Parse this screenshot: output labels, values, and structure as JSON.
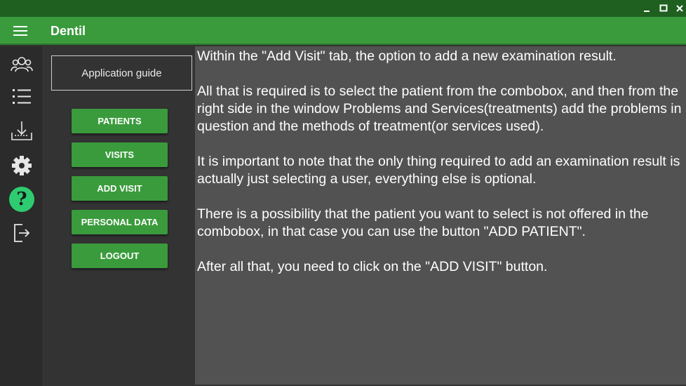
{
  "window": {
    "controls": [
      {
        "name": "minimize-icon",
        "glyph": "_"
      },
      {
        "name": "maximize-icon",
        "glyph": "□"
      },
      {
        "name": "close-icon",
        "glyph": "✕"
      }
    ]
  },
  "appbar": {
    "title": "Dentil",
    "menu_icon": "hamburger-menu-icon"
  },
  "rail": {
    "items": [
      {
        "icon": "users-icon"
      },
      {
        "icon": "list-icon"
      },
      {
        "icon": "inbox-download-icon"
      },
      {
        "icon": "gear-icon"
      },
      {
        "icon": "help-icon",
        "glyph": "?",
        "active": true
      },
      {
        "icon": "logout-icon"
      }
    ]
  },
  "menu": {
    "guide_label": "Application guide",
    "buttons": [
      {
        "label": "PATIENTS"
      },
      {
        "label": "VISITS"
      },
      {
        "label": "ADD VISIT"
      },
      {
        "label": "PERSONAL DATA"
      },
      {
        "label": "LOGOUT"
      }
    ]
  },
  "content": {
    "paragraphs": [
      "Within the \"Add Visit\" tab, the option to add a new examination result.",
      "All that is required is to select the patient from the combobox, and then from the right side in the window Problems and Services(treatments) add the problems in question and the methods of treatment(or services used).",
      "It is important to note that the only thing required to add an examination result is actually just selecting a user, everything else is optional.",
      "There is a possibility that the patient you want to select is not offered in the combobox, in that case you can use the button \"ADD PATIENT\".",
      "After all that, you need to click on the \"ADD VISIT\" button."
    ]
  },
  "colors": {
    "titlebar": "#1f5f20",
    "appbar": "#3a9b3c",
    "accent_help": "#2ecc71",
    "content_bg": "#525252"
  }
}
